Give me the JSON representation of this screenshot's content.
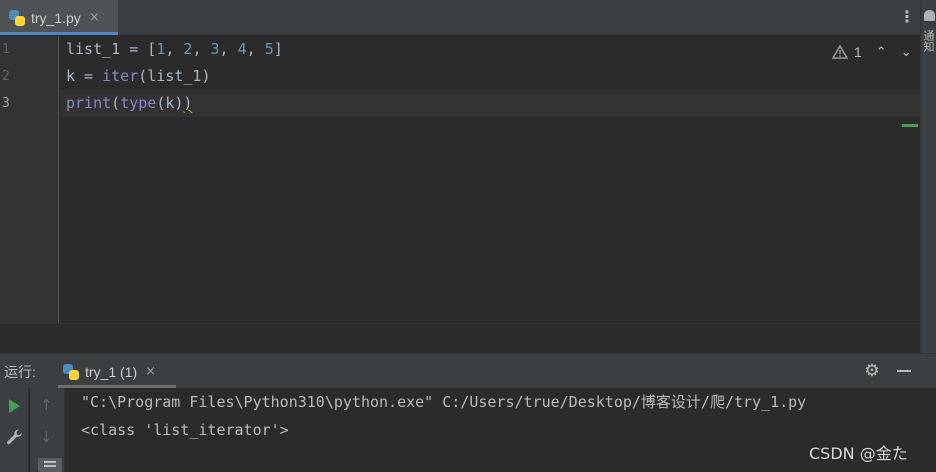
{
  "editor_tab": {
    "filename": "try_1.py",
    "close": "×"
  },
  "right_strip": {
    "label": "通知"
  },
  "editor": {
    "line_numbers": [
      "1",
      "2",
      "3"
    ],
    "lines": {
      "l1": {
        "p1": "list_1 = [",
        "n1": "1",
        "c1": ", ",
        "n2": "2",
        "c2": ", ",
        "n3": "3",
        "c3": ", ",
        "n4": "4",
        "c4": ", ",
        "n5": "5",
        "end": "]"
      },
      "l2": {
        "p1": "k = ",
        "fn": "iter",
        "p2": "(list_1)"
      },
      "l3": {
        "fn1": "print",
        "p1": "(",
        "fn2": "type",
        "p2": "(k)",
        "p3": ")"
      }
    },
    "inspection": {
      "warnings": "1",
      "up": "⌃",
      "down": "⌄"
    }
  },
  "run_window": {
    "label": "运行:",
    "tab": {
      "name": "try_1 (1)",
      "close": "×"
    },
    "console": [
      "\"C:\\Program Files\\Python310\\python.exe\" C:/Users/true/Desktop/博客设计/爬/try_1.py",
      "<class 'list_iterator'>"
    ]
  },
  "icons": {
    "more": "⋮",
    "gear": "⚙",
    "up": "↑",
    "down": "↓"
  },
  "colors": {
    "accent_tab": "#4a88c7",
    "number": "#6897bb",
    "builtin": "#8888c6",
    "run_green": "#499c54"
  },
  "watermark": "CSDN @金た"
}
